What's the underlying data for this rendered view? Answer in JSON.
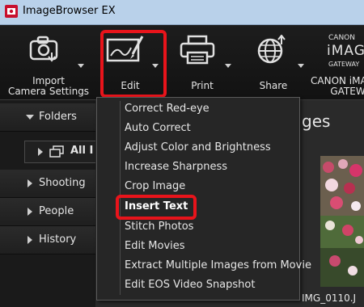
{
  "window": {
    "title": "ImageBrowser EX"
  },
  "toolbar": {
    "import": {
      "label_line1": "Import",
      "label_line2": "Camera Settings"
    },
    "edit": {
      "label": "Edit"
    },
    "print": {
      "label": "Print"
    },
    "share": {
      "label": "Share"
    },
    "gateway": {
      "brand_line1": "CANON",
      "brand_line2": "iMAGE",
      "brand_line3": "GATEWAY",
      "label_line1": "CANON iMAGE",
      "label_line2": "GATEWAY"
    }
  },
  "left_panel": {
    "folders": {
      "label": "Folders"
    },
    "all_folders": {
      "label": "All I"
    },
    "shooting": {
      "label": "Shooting"
    },
    "people": {
      "label": "People"
    },
    "history": {
      "label": "History"
    }
  },
  "main": {
    "title_fragment": "ges",
    "thumbnail_caption": "IMG_0110.J"
  },
  "edit_menu": {
    "items": [
      "Correct Red-eye",
      "Auto Correct",
      "Adjust Color and Brightness",
      "Increase Sharpness",
      "Crop Image",
      "Insert Text",
      "Stitch Photos",
      "Edit Movies",
      "Extract Multiple Images from Movie",
      "Edit EOS Video Snapshot"
    ],
    "highlighted": "Insert Text"
  },
  "colors": {
    "highlight_red": "#e8141b",
    "toolbar_bg": "#121212",
    "menu_bg": "#262626",
    "titlebar_bg": "#b9d1ea"
  }
}
